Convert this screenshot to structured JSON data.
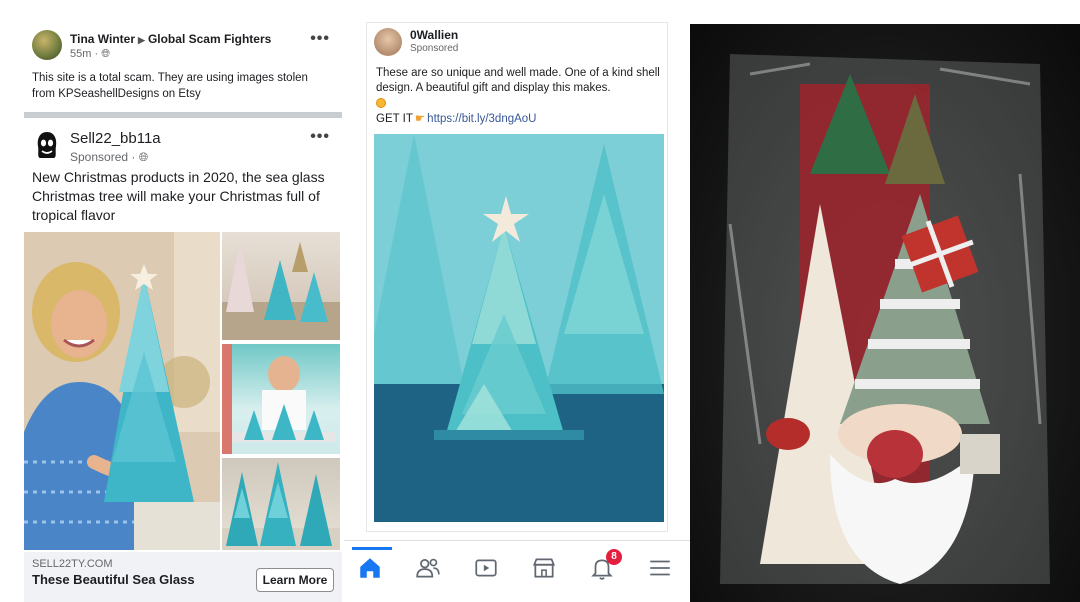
{
  "left_panel": {
    "post": {
      "author": "Tina Winter",
      "group": "Global Scam Fighters",
      "time": "55m",
      "text": "This site is a total scam. They are using images stolen from KPSeashellDesigns on Etsy",
      "more": "•••"
    },
    "ad": {
      "name": "Sell22_bb11a",
      "sponsored": "Sponsored · ",
      "text": "New Christmas products in 2020, the sea glass Christmas tree will make your Christmas full of tropical flavor",
      "more": "•••",
      "domain": "SELL22TY.COM",
      "title": "These Beautiful Sea Glass",
      "cta": "Learn More"
    }
  },
  "middle_panel": {
    "name": "0Wallien",
    "sponsored": "Sponsored",
    "text": "These are so unique and well made. One of a kind shell design. A beautiful gift and display this makes.",
    "get_it": "GET IT",
    "link": "https://bit.ly/3dngAoU",
    "tabs": [
      {
        "name": "home-icon"
      },
      {
        "name": "friends-icon"
      },
      {
        "name": "watch-icon"
      },
      {
        "name": "marketplace-icon"
      },
      {
        "name": "bell-icon",
        "badge": "8"
      },
      {
        "name": "menu-icon"
      }
    ],
    "accent": "#1877f2"
  }
}
